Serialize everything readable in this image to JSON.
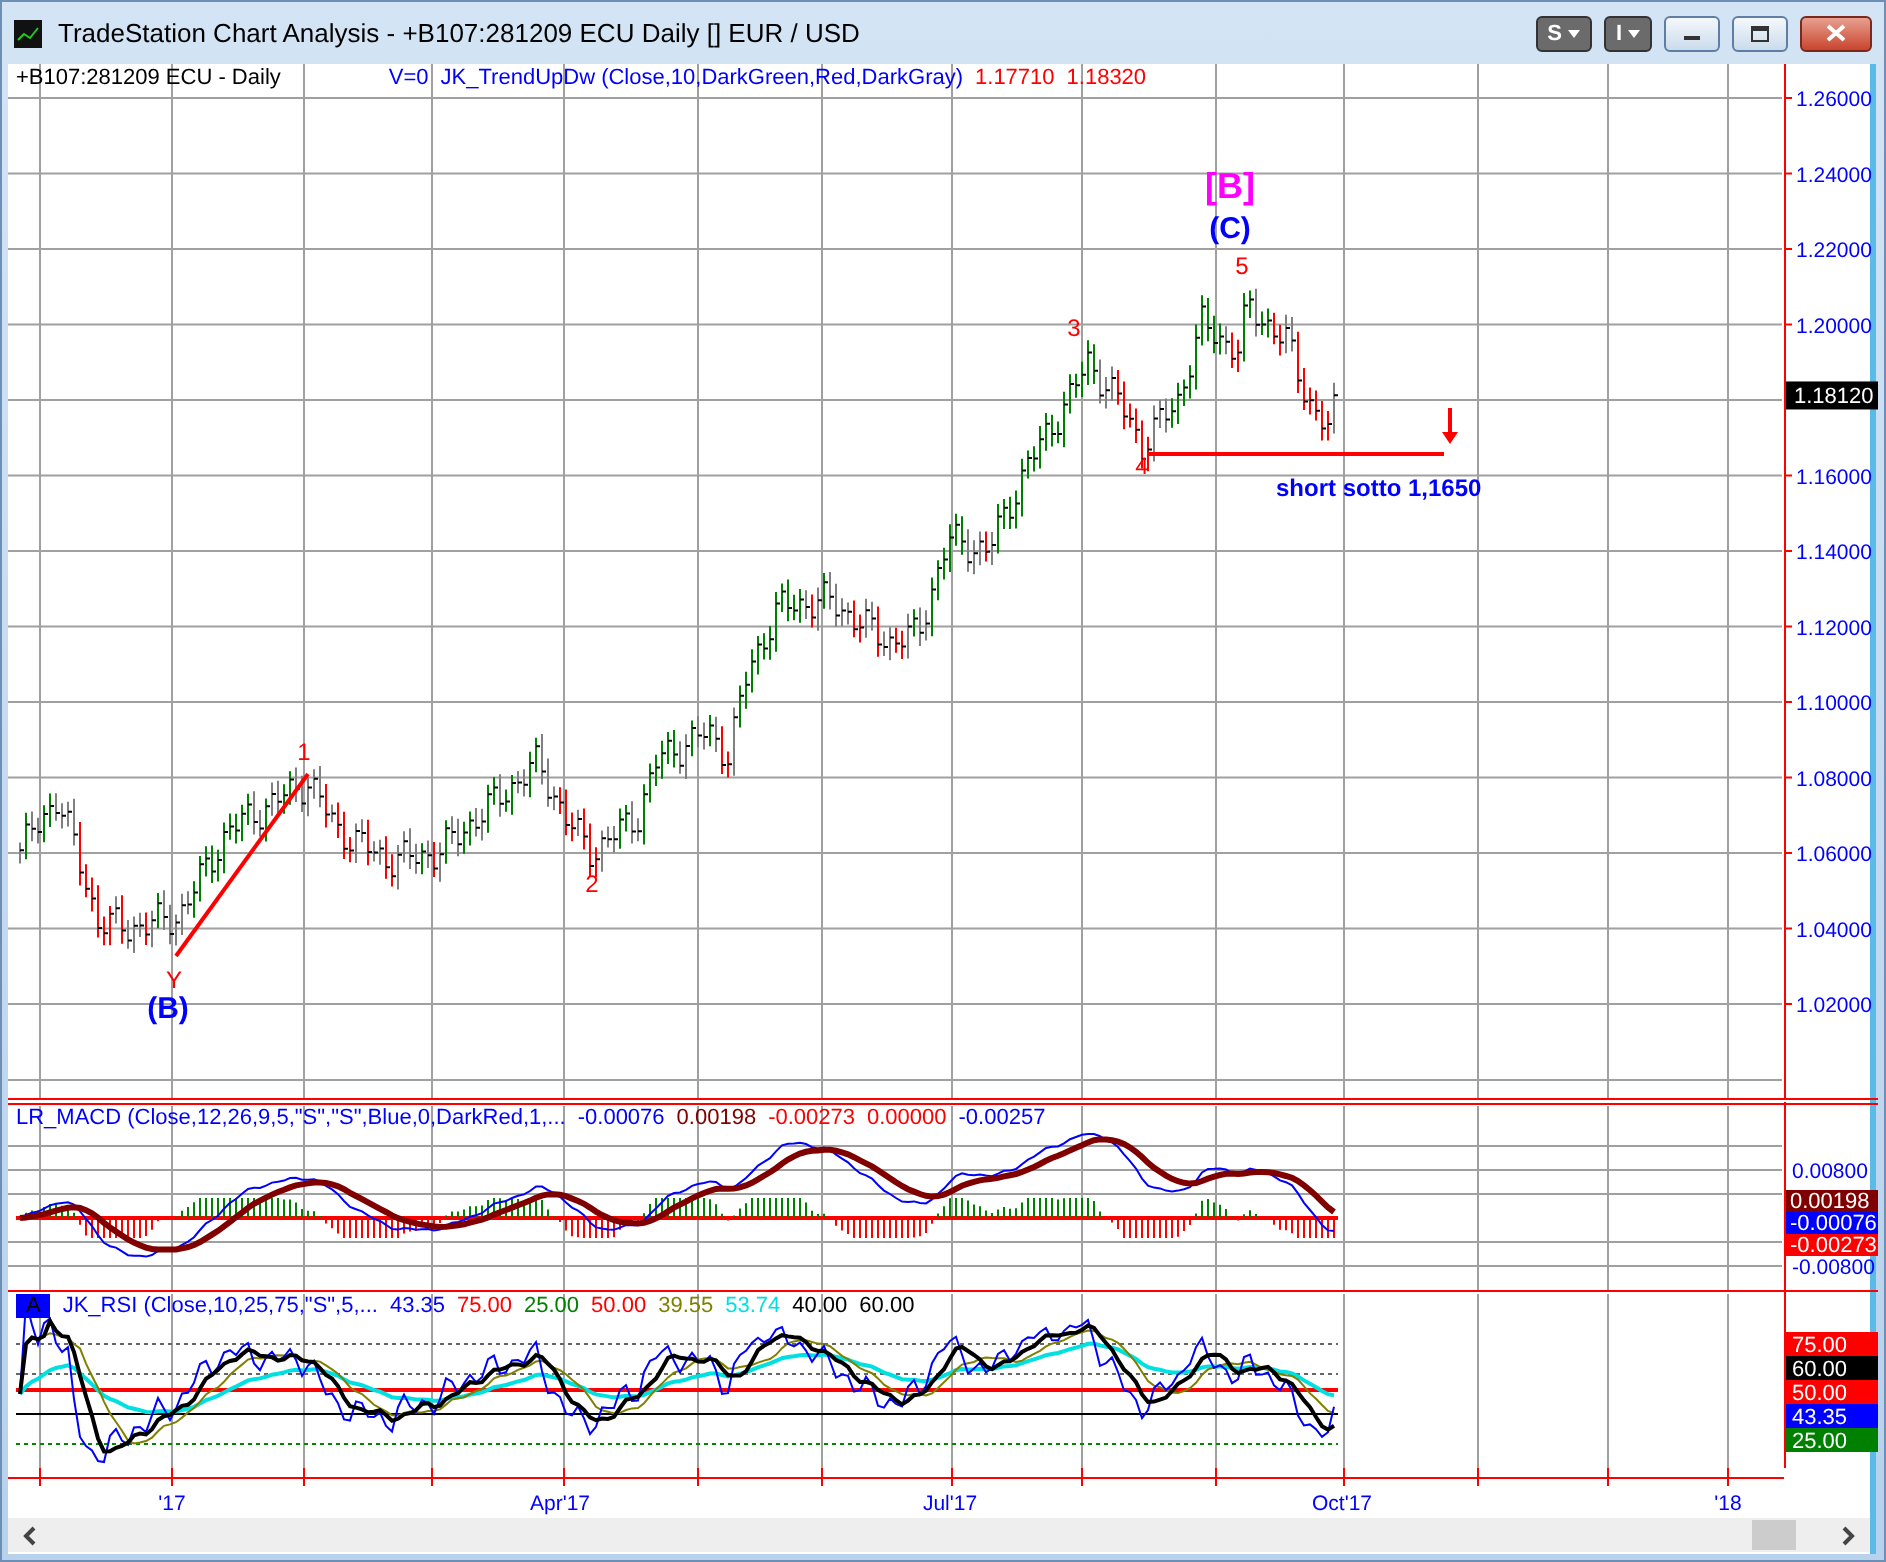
{
  "window": {
    "title": "TradeStation Chart Analysis - +B107:281209 ECU Daily [] EUR / USD",
    "menu_buttons": [
      {
        "label": "S"
      },
      {
        "label": "I"
      }
    ]
  },
  "main_panel": {
    "symbol": "+B107:281209 ECU - Daily",
    "study_flag": "V=0",
    "study": "JK_TrendUpDw (Close,10,DarkGreen,Red,DarkGray)",
    "values": [
      {
        "text": "1.17710",
        "color": "#ff0000"
      },
      {
        "text": "1.18320",
        "color": "#ff0000"
      }
    ],
    "y_axis": [
      "1.26000",
      "1.24000",
      "1.22000",
      "1.20000",
      "1.16000",
      "1.14000",
      "1.12000",
      "1.10000",
      "1.08000",
      "1.06000",
      "1.04000",
      "1.02000"
    ],
    "last_price": "1.18120",
    "annotations": [
      {
        "kind": "major",
        "text": "[B]",
        "color": "#ff00ff"
      },
      {
        "kind": "degree",
        "text": "(C)",
        "color": "#0000ff"
      },
      {
        "kind": "count",
        "text": "5",
        "color": "#ff0000"
      },
      {
        "kind": "count",
        "text": "3",
        "color": "#ff0000"
      },
      {
        "kind": "count",
        "text": "4",
        "color": "#ff0000"
      },
      {
        "kind": "count",
        "text": "2",
        "color": "#ff0000"
      },
      {
        "kind": "count",
        "text": "1",
        "color": "#ff0000"
      },
      {
        "kind": "count",
        "text": "Y",
        "color": "#ff0000"
      },
      {
        "kind": "degree",
        "text": "(B)",
        "color": "#0000ff"
      },
      {
        "kind": "note",
        "text": "short sotto 1,1650",
        "color": "#0000ff"
      }
    ]
  },
  "macd_panel": {
    "study": "LR_MACD (Close,12,26,9,5,\"S\",\"S\",Blue,0,DarkRed,1,...",
    "values": [
      {
        "text": "-0.00076",
        "color": "#0000ff"
      },
      {
        "text": "0.00198",
        "color": "#800000"
      },
      {
        "text": "-0.00273",
        "color": "#ff0000"
      },
      {
        "text": "0.00000",
        "color": "#ff0000"
      },
      {
        "text": "-0.00257",
        "color": "#0000ff"
      }
    ],
    "y_axis": [
      "0.00800",
      "-0.00800"
    ],
    "badges": [
      {
        "text": "0.00198",
        "color": "#800000"
      },
      {
        "text": "-0.00076",
        "color": "#0000ff"
      },
      {
        "text": "-0.00273",
        "color": "#ff0000"
      }
    ]
  },
  "rsi_panel": {
    "tag": "A",
    "study": "JK_RSI (Close,10,25,75,\"S\",5,...",
    "values": [
      {
        "text": "43.35",
        "color": "#0000ff"
      },
      {
        "text": "75.00",
        "color": "#ff0000"
      },
      {
        "text": "25.00",
        "color": "#008000"
      },
      {
        "text": "50.00",
        "color": "#ff0000"
      },
      {
        "text": "39.55",
        "color": "#808000"
      },
      {
        "text": "53.74",
        "color": "#00e0e0"
      },
      {
        "text": "40.00",
        "color": "#000000"
      },
      {
        "text": "60.00",
        "color": "#000000"
      }
    ],
    "badges": [
      {
        "text": "75.00",
        "color": "#ff0000"
      },
      {
        "text": "60.00",
        "color": "#000000"
      },
      {
        "text": "50.00",
        "color": "#ff0000"
      },
      {
        "text": "43.35",
        "color": "#0000ff"
      },
      {
        "text": "25.00",
        "color": "#008000"
      }
    ]
  },
  "time_axis": [
    "'17",
    "Apr'17",
    "Jul'17",
    "Oct'17",
    "'18"
  ]
}
